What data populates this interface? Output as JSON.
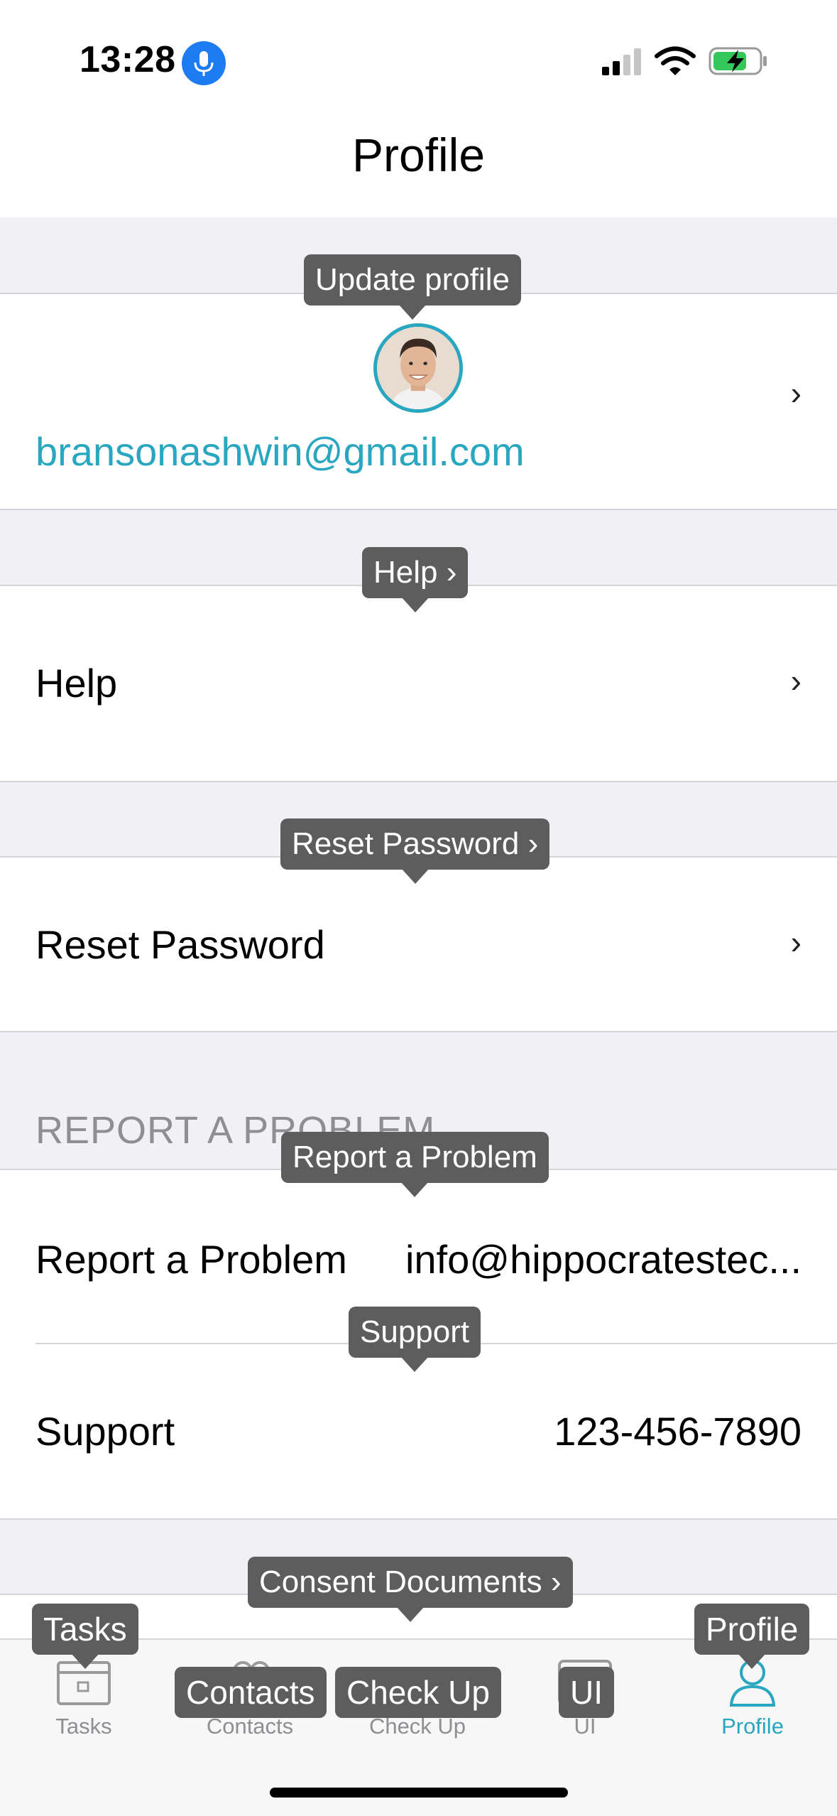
{
  "status_bar": {
    "time": "13:28",
    "icons": [
      "microphone-icon",
      "cellular-signal-icon",
      "wifi-icon",
      "battery-charging-icon"
    ]
  },
  "nav": {
    "title": "Profile"
  },
  "profile": {
    "email": "bransonashwin@gmail.com",
    "tooltip": "Update profile"
  },
  "rows": {
    "help": {
      "label": "Help",
      "tooltip": "Help ›"
    },
    "reset_password": {
      "label": "Reset Password",
      "tooltip": "Reset Password ›"
    }
  },
  "report_section": {
    "header": "REPORT A PROBLEM",
    "report": {
      "label": "Report a Problem",
      "value": "info@hippocratestec...",
      "tooltip": "Report a Problem"
    },
    "support": {
      "label": "Support",
      "value": "123-456-7890",
      "tooltip": "Support"
    }
  },
  "consent": {
    "tooltip": "Consent Documents ›"
  },
  "chevron": "›",
  "tabs": [
    {
      "label": "Tasks",
      "tooltip": "Tasks",
      "icon": "calendar-icon",
      "active": false
    },
    {
      "label": "Contacts",
      "tooltip": "Contacts",
      "icon": "contacts-icon",
      "active": false
    },
    {
      "label": "Check Up",
      "tooltip": "Check Up",
      "icon": "checkup-icon",
      "active": false
    },
    {
      "label": "UI",
      "tooltip": "UI",
      "icon": "ui-icon",
      "active": false
    },
    {
      "label": "Profile",
      "tooltip": "Profile",
      "icon": "profile-icon",
      "active": true
    }
  ],
  "colors": {
    "accent": "#2aa7c0",
    "tooltip_bg": "#5d5d5d",
    "grouped_bg": "#f0f0f5",
    "mic_blue": "#1d7cf2",
    "battery_green": "#34c759"
  }
}
